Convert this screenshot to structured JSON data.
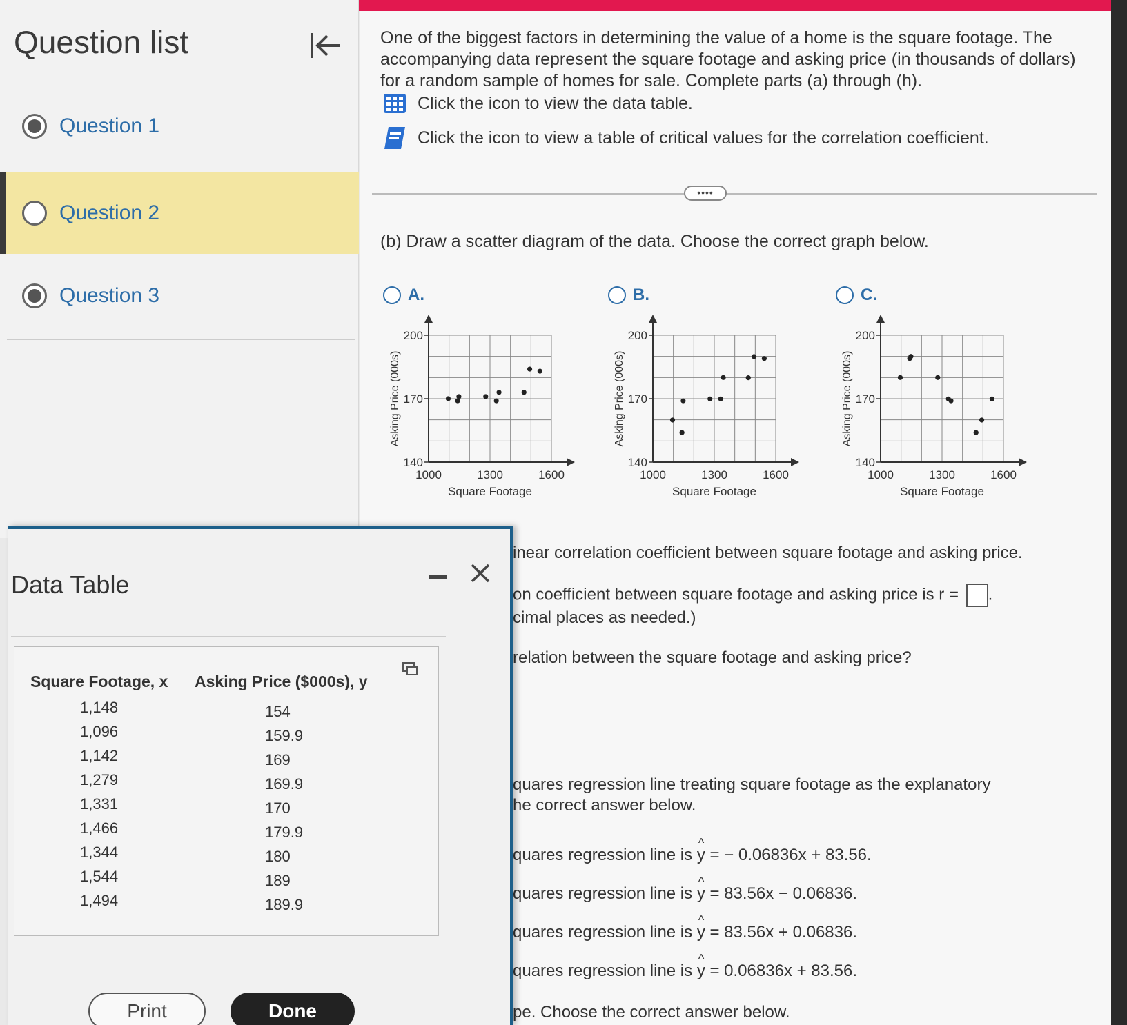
{
  "sidebar": {
    "title": "Question list",
    "items": [
      {
        "label": "Question 1",
        "state": "answered"
      },
      {
        "label": "Question 2",
        "state": "current"
      },
      {
        "label": "Question 3",
        "state": "answered"
      }
    ]
  },
  "main": {
    "intro": "One of the biggest factors in determining the value of a home is the square footage. The accompanying data represent the square footage and asking price (in thousands of dollars) for a random sample of homes for sale. Complete parts (a) through (h).",
    "link_data_table": "Click the icon to view the data table.",
    "link_critical_values": "Click the icon to view a table of critical values for the correlation coefficient.",
    "separator_label": "••••",
    "part_b": "(b) Draw a scatter diagram of the data. Choose the correct graph below.",
    "options": [
      "A.",
      "B.",
      "C."
    ],
    "line_c1": "inear correlation coefficient between square footage and asking price.",
    "line_c2a": "on coefficient between square footage and asking price is r =",
    "line_c2b": "cimal places as needed.)",
    "line_d": "relation between the square footage and asking price?",
    "line_e1": "quares regression line treating square footage as the explanatory",
    "line_e2": "he correct answer below.",
    "reg_prefix": "quares regression line is",
    "reg_options": [
      "= − 0.06836x + 83.56.",
      "= 83.56x − 0.06836.",
      "= 83.56x + 0.06836.",
      "= 0.06836x + 83.56."
    ],
    "line_f": "pe. Choose the correct answer below."
  },
  "chart_data": [
    {
      "type": "scatter",
      "option": "A",
      "xlabel": "Square Footage",
      "ylabel": "Asking Price (000s)",
      "xlim": [
        1000,
        1600
      ],
      "ylim": [
        140,
        200
      ],
      "xticks": [
        1000,
        1300,
        1600
      ],
      "yticks": [
        140,
        170,
        200
      ],
      "grid": true,
      "x": [
        1096,
        1142,
        1148,
        1279,
        1331,
        1344,
        1466,
        1494,
        1544
      ],
      "y": [
        170,
        169,
        171,
        171,
        169,
        173,
        173,
        184,
        183
      ]
    },
    {
      "type": "scatter",
      "option": "B",
      "xlabel": "Square Footage",
      "ylabel": "Asking Price (000s)",
      "xlim": [
        1000,
        1600
      ],
      "ylim": [
        140,
        200
      ],
      "xticks": [
        1000,
        1300,
        1600
      ],
      "yticks": [
        140,
        170,
        200
      ],
      "grid": true,
      "x": [
        1096,
        1142,
        1148,
        1279,
        1331,
        1344,
        1466,
        1494,
        1544
      ],
      "y": [
        159.9,
        154,
        169,
        169.9,
        169.9,
        180,
        179.9,
        189.9,
        189
      ]
    },
    {
      "type": "scatter",
      "option": "C",
      "xlabel": "Square Footage",
      "ylabel": "Asking Price (000s)",
      "xlim": [
        1000,
        1600
      ],
      "ylim": [
        140,
        200
      ],
      "xticks": [
        1000,
        1300,
        1600
      ],
      "yticks": [
        140,
        170,
        200
      ],
      "grid": true,
      "x": [
        1142,
        1148,
        1096,
        1279,
        1331,
        1344,
        1466,
        1494,
        1544
      ],
      "y": [
        189,
        190,
        180,
        180,
        169.9,
        169,
        154,
        159.9,
        169.9
      ]
    }
  ],
  "data_table": {
    "title": "Data Table",
    "headers": [
      "Square Footage, x",
      "Asking Price ($000s), y"
    ],
    "rows": [
      [
        "1,148",
        "154"
      ],
      [
        "1,096",
        "159.9"
      ],
      [
        "1,142",
        "169"
      ],
      [
        "1,279",
        "169.9"
      ],
      [
        "1,331",
        "170"
      ],
      [
        "1,466",
        "179.9"
      ],
      [
        "1,344",
        "180"
      ],
      [
        "1,544",
        "189"
      ],
      [
        "1,494",
        "189.9"
      ]
    ],
    "print_label": "Print",
    "done_label": "Done"
  }
}
